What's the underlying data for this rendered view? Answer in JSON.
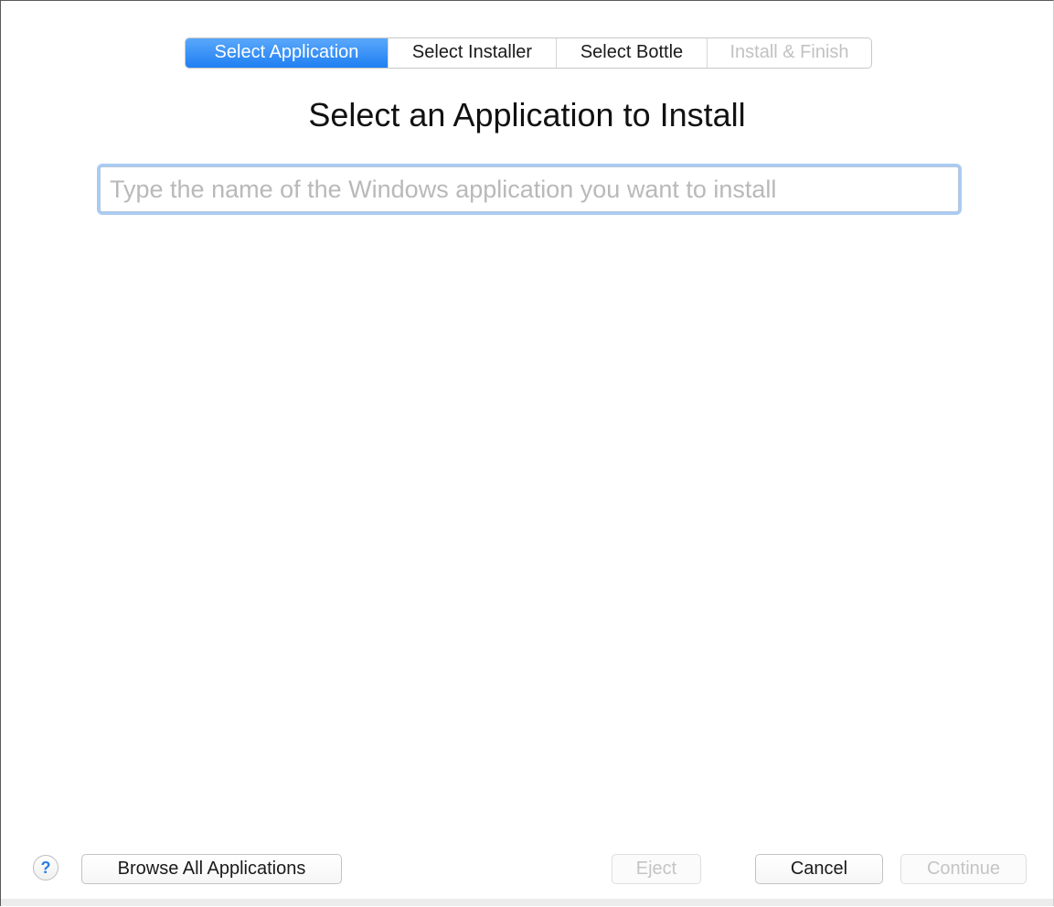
{
  "steps": [
    {
      "label": "Select Application",
      "state": "active"
    },
    {
      "label": "Select Installer",
      "state": "normal"
    },
    {
      "label": "Select Bottle",
      "state": "normal"
    },
    {
      "label": "Install & Finish",
      "state": "disabled"
    }
  ],
  "main": {
    "title": "Select an Application to Install",
    "search": {
      "value": "",
      "placeholder": "Type the name of the Windows application you want to install"
    }
  },
  "footer": {
    "help_glyph": "?",
    "browse_label": "Browse All Applications",
    "eject_label": "Eject",
    "cancel_label": "Cancel",
    "continue_label": "Continue"
  },
  "colors": {
    "accent": "#1f7ff2",
    "focus_ring": "#a9cbf3",
    "disabled_text": "#c2c2c2"
  },
  "icons": {
    "help": "help-icon"
  }
}
